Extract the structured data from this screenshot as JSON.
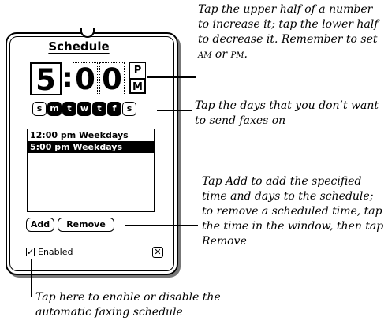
{
  "panel": {
    "title": "Schedule",
    "time": {
      "hour": "5",
      "colon": ":",
      "minute_tens": "0",
      "minute_ones": "0",
      "am": "P",
      "pm": "M"
    },
    "days": [
      {
        "label": "s",
        "selected": false
      },
      {
        "label": "m",
        "selected": true
      },
      {
        "label": "t",
        "selected": true
      },
      {
        "label": "w",
        "selected": true
      },
      {
        "label": "t",
        "selected": true
      },
      {
        "label": "f",
        "selected": true
      },
      {
        "label": "s",
        "selected": false
      }
    ],
    "list": [
      {
        "text": "12:00 pm Weekdays",
        "selected": false
      },
      {
        "text": "5:00 pm Weekdays",
        "selected": true
      }
    ],
    "add_label": "Add",
    "remove_label": "Remove",
    "enabled_label": "Enabled",
    "enabled_checked": true
  },
  "callouts": {
    "time": {
      "pre": "Tap the upper half of a number to increase it; tap the lower half to decrease it. Remember to set ",
      "am": "AM",
      "mid": " or ",
      "pm": "PM",
      "post": "."
    },
    "days": "Tap the days that you don’t want to send faxes on",
    "add_remove": "Tap Add to add the specified time and days to the schedule; to remove a scheduled time, tap the time in the window, then tap Remove",
    "enabled": "Tap here to enable or disable the automatic faxing schedule"
  }
}
